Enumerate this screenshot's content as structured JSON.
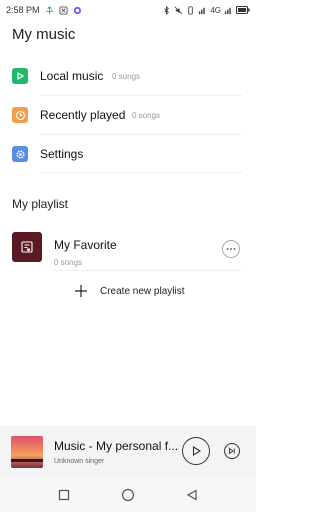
{
  "status_bar": {
    "time": "2:58 PM",
    "network": "4G"
  },
  "page_title": "My music",
  "menu": [
    {
      "label": "Local music",
      "count": "0 songs",
      "icon": "play-icon",
      "color": "#1fb86b"
    },
    {
      "label": "Recently played",
      "count": "0 songs",
      "icon": "clock-icon",
      "color": "#f0a04b"
    },
    {
      "label": "Settings",
      "icon": "gear-icon",
      "color": "#5b8de6"
    }
  ],
  "playlist_section_title": "My playlist",
  "playlists": [
    {
      "name": "My Favorite",
      "count": "0 songs",
      "icon": "favorite-list-icon",
      "color": "#5a1a22"
    }
  ],
  "create_playlist_label": "Create new playlist",
  "now_playing": {
    "title": "Music - My personal f...",
    "artist": "Unknown singer"
  },
  "colors": {
    "accent_green": "#1fb86b",
    "accent_orange": "#f0a04b",
    "accent_blue": "#5b8de6",
    "player_bg": "#f4f4f4"
  }
}
